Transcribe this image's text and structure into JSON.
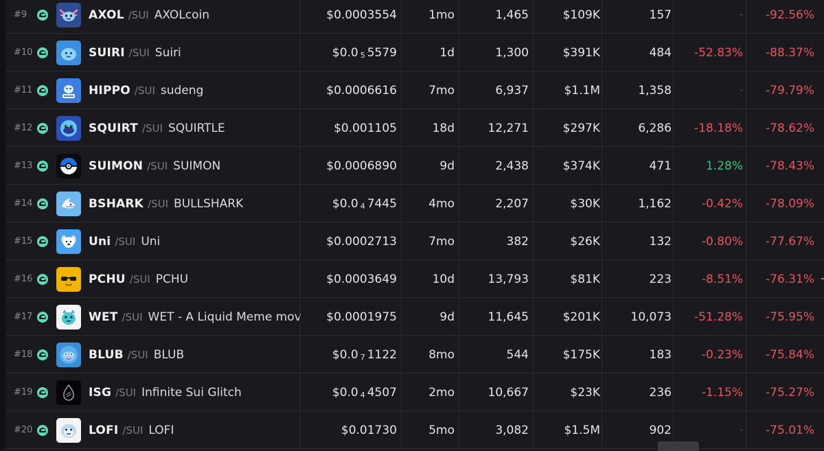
{
  "chain_label": "/SUI",
  "rows": [
    {
      "rank": "#9",
      "ticker": "AXOL",
      "name": "AXOLcoin",
      "price_main": "$0.0003554",
      "price_pre": "",
      "price_sub": "",
      "price_post": "",
      "age": "1mo",
      "txns": "1,465",
      "volume": "$109K",
      "makers": "157",
      "change_a": "-",
      "change_b": "-92.56%",
      "logo_icon": "axolotl-icon",
      "logo_bg": "#2e4d92"
    },
    {
      "rank": "#10",
      "ticker": "SUIRI",
      "name": "Suiri",
      "price_main": "",
      "price_pre": "$0.0",
      "price_sub": "5",
      "price_post": "5579",
      "age": "1d",
      "txns": "1,300",
      "volume": "$391K",
      "makers": "484",
      "change_a": "-52.83%",
      "change_b": "-88.37%",
      "logo_icon": "blob-icon",
      "logo_bg": "#3b8fe0"
    },
    {
      "rank": "#11",
      "ticker": "HIPPO",
      "name": "sudeng",
      "price_main": "$0.0006616",
      "price_pre": "",
      "price_sub": "",
      "price_post": "",
      "age": "7mo",
      "txns": "6,937",
      "volume": "$1.1M",
      "makers": "1,358",
      "change_a": "-",
      "change_b": "-79.79%",
      "logo_icon": "hippo-icon",
      "logo_bg": "#3d7fe0"
    },
    {
      "rank": "#12",
      "ticker": "SQUIRT",
      "name": "SQUIRTLE",
      "price_main": "$0.001105",
      "price_pre": "",
      "price_sub": "",
      "price_post": "",
      "age": "18d",
      "txns": "12,271",
      "volume": "$297K",
      "makers": "6,286",
      "change_a": "-18.18%",
      "change_b": "-78.62%",
      "logo_icon": "turtle-icon",
      "logo_bg": "#2b4fb8"
    },
    {
      "rank": "#13",
      "ticker": "SUIMON",
      "name": "SUIMON",
      "price_main": "$0.0006890",
      "price_pre": "",
      "price_sub": "",
      "price_post": "",
      "age": "9d",
      "txns": "2,438",
      "volume": "$374K",
      "makers": "471",
      "change_a": "1.28%",
      "change_b": "-78.43%",
      "logo_icon": "pokeball-icon",
      "logo_bg": "#0c0c10"
    },
    {
      "rank": "#14",
      "ticker": "BSHARK",
      "name": "BULLSHARK",
      "price_main": "",
      "price_pre": "$0.0",
      "price_sub": "4",
      "price_post": "7445",
      "age": "4mo",
      "txns": "2,207",
      "volume": "$30K",
      "makers": "1,162",
      "change_a": "-0.42%",
      "change_b": "-78.09%",
      "logo_icon": "shark-icon",
      "logo_bg": "#6fb8f0"
    },
    {
      "rank": "#15",
      "ticker": "Uni",
      "name": "Uni",
      "price_main": "$0.0002713",
      "price_pre": "",
      "price_sub": "",
      "price_post": "",
      "age": "7mo",
      "txns": "382",
      "volume": "$26K",
      "makers": "132",
      "change_a": "-0.80%",
      "change_b": "-77.67%",
      "logo_icon": "dog-icon",
      "logo_bg": "#4aa3f0"
    },
    {
      "rank": "#16",
      "ticker": "PCHU",
      "name": "PCHU",
      "price_main": "$0.0003649",
      "price_pre": "",
      "price_sub": "",
      "price_post": "",
      "age": "10d",
      "txns": "13,793",
      "volume": "$81K",
      "makers": "223",
      "change_a": "-8.51%",
      "change_b": "-76.31%",
      "logo_icon": "sunglasses-icon",
      "logo_bg": "#f2b400"
    },
    {
      "rank": "#17",
      "ticker": "WET",
      "name": "WET - A Liquid Meme mov",
      "price_main": "$0.0001975",
      "price_pre": "",
      "price_sub": "",
      "price_post": "",
      "age": "9d",
      "txns": "11,645",
      "volume": "$201K",
      "makers": "10,073",
      "change_a": "-51.28%",
      "change_b": "-75.95%",
      "logo_icon": "cat-icon",
      "logo_bg": "#f4f4f4"
    },
    {
      "rank": "#18",
      "ticker": "BLUB",
      "name": "BLUB",
      "price_main": "",
      "price_pre": "$0.0",
      "price_sub": "7",
      "price_post": "1122",
      "age": "8mo",
      "txns": "544",
      "volume": "$175K",
      "makers": "183",
      "change_a": "-0.23%",
      "change_b": "-75.84%",
      "logo_icon": "fish-icon",
      "logo_bg": "#3a8fd6"
    },
    {
      "rank": "#19",
      "ticker": "ISG",
      "name": "Infinite Sui Glitch",
      "price_main": "",
      "price_pre": "$0.0",
      "price_sub": "4",
      "price_post": "4507",
      "age": "2mo",
      "txns": "10,667",
      "volume": "$23K",
      "makers": "236",
      "change_a": "-1.15%",
      "change_b": "-75.27%",
      "logo_icon": "glitch-drop-icon",
      "logo_bg": "#060608"
    },
    {
      "rank": "#20",
      "ticker": "LOFI",
      "name": "LOFI",
      "price_main": "$0.01730",
      "price_pre": "",
      "price_sub": "",
      "price_post": "",
      "age": "5mo",
      "txns": "3,082",
      "volume": "$1.5M",
      "makers": "902",
      "change_a": "-",
      "change_b": "-75.01%",
      "logo_icon": "yeti-icon",
      "logo_bg": "#f4f4f4"
    }
  ]
}
